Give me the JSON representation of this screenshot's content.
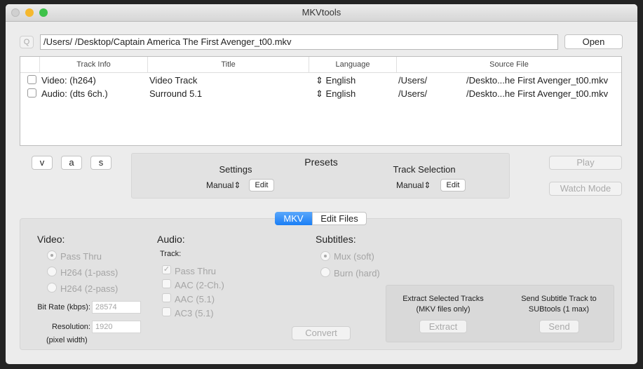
{
  "window": {
    "title": "MKVtools"
  },
  "file": {
    "search_icon_label": "Q",
    "path": "/Users/            /Desktop/Captain America The First Avenger_t00.mkv",
    "open_label": "Open"
  },
  "table": {
    "headers": [
      "Track Info",
      "Title",
      "Language",
      "Source File"
    ],
    "rows": [
      {
        "checked": false,
        "info": "Video: (h264)",
        "title": "Video Track",
        "language": "English",
        "source_dir": "/Users/",
        "source_file": "/Deskto...he First Avenger_t00.mkv"
      },
      {
        "checked": false,
        "info": "Audio: (dts 6ch.)",
        "title": "Surround 5.1",
        "language": "English",
        "source_dir": "/Users/",
        "source_file": "/Deskto...he First Avenger_t00.mkv"
      }
    ]
  },
  "filters": [
    "v",
    "a",
    "s"
  ],
  "presets": {
    "title": "Presets",
    "settings_label": "Settings",
    "settings_value": "Manual",
    "track_label": "Track Selection",
    "track_value": "Manual",
    "edit_label": "Edit"
  },
  "side_buttons": {
    "play": "Play",
    "watch": "Watch Mode"
  },
  "tabs": [
    {
      "label": "MKV",
      "active": true
    },
    {
      "label": "Edit Files",
      "active": false
    }
  ],
  "video": {
    "heading": "Video:",
    "options": [
      "Pass Thru",
      "H264 (1-pass)",
      "H264 (2-pass)"
    ],
    "selected": 0,
    "bitrate_label": "Bit Rate (kbps):",
    "bitrate": "28574",
    "resolution_label": "Resolution:",
    "resolution": "1920",
    "resolution_hint": "(pixel width)"
  },
  "audio": {
    "heading": "Audio:",
    "track_label": "Track:",
    "options": [
      "Pass Thru",
      "AAC (2-Ch.)",
      "AAC (5.1)",
      "AC3 (5.1)"
    ],
    "checked": [
      true,
      false,
      false,
      false
    ]
  },
  "subtitles": {
    "heading": "Subtitles:",
    "options": [
      "Mux (soft)",
      "Burn (hard)"
    ],
    "selected": 0
  },
  "convert_label": "Convert",
  "extract": {
    "text1": "Extract Selected Tracks",
    "text2": "(MKV files only)",
    "button": "Extract"
  },
  "send": {
    "text1": "Send Subtitle Track to",
    "text2": "SUBtools (1 max)",
    "button": "Send"
  }
}
